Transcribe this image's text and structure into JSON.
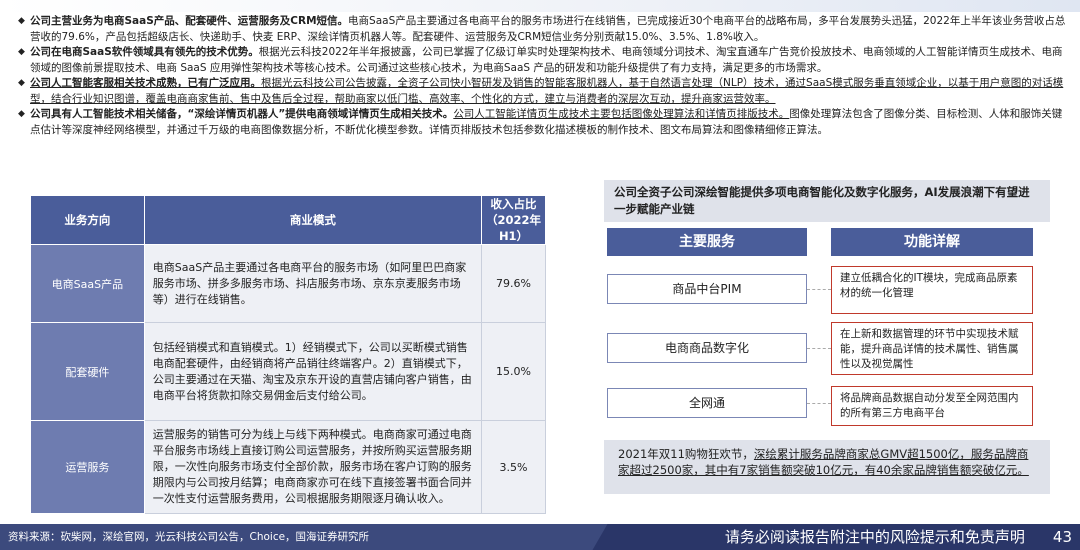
{
  "bullets": [
    {
      "head": "公司主营业务为电商SaaS产品、配套硬件、运营服务及CRM短信。",
      "body": "电商SaaS产品主要通过各电商平台的服务市场进行在线销售，已完成接近30个电商平台的战略布局，多平台发展势头迅猛，2022年上半年该业务营收占总营收的79.6%，产品包括超级店长、快递助手、快麦 ERP、深绘详情页机器人等。配套硬件、运营服务及CRM短信业务分别贡献15.0%、3.5%、1.8%收入。"
    },
    {
      "head": "公司在电商SaaS软件领域具有领先的技术优势。",
      "body": "根据光云科技2022年半年报披露，公司已掌握了亿级订单实时处理架构技术、电商领域分词技术、淘宝直通车广告竞价投放技术、电商领域的人工智能详情页生成技术、电商领域的图像前景提取技术、电商 SaaS 应用弹性架构技术等核心技术。公司通过这些核心技术，为电商SaaS 产品的研发和功能升级提供了有力支持，满足更多的市场需求。"
    },
    {
      "head": "公司人工智能客服相关技术成熟，已有广泛应用。",
      "body": "根据光云科技公司公告披露，全资子公司快小智研发及销售的智能客服机器人，基于自然语言处理（NLP）技术，通过SaaS模式服务垂直领域企业，以基于用户意图的对话模型，结合行业知识图谱，覆盖电商商家售前、售中及售后全过程，帮助商家以低门槛、高效率、个性化的方式，建立与消费者的深层次互动，提升商家运营效率。"
    },
    {
      "head": "公司具有人工智能技术相关储备，“深绘详情页机器人”提供电商领域详情页生成相关技术。",
      "body": "公司人工智能详情页生成技术主要包括图像处理算法和详情页排版技术。图像处理算法包含了图像分类、目标检测、人体和服饰关键点估计等深度神经网络模型，并通过千万级的电商图像数据分析，不断优化模型参数。详情页排版技术包括参数化描述模板的制作技术、图文布局算法和图像精细修正算法。",
      "body_underlined": "公司人工智能详情页生成技术主要包括图像处理算法和详情页排版技术。",
      "body_rest": "图像处理算法包含了图像分类、目标检测、人体和服饰关键点估计等深度神经网络模型，并通过千万级的电商图像数据分析，不断优化模型参数。详情页排版技术包括参数化描述模板的制作技术、图文布局算法和图像精细修正算法。"
    }
  ],
  "table": {
    "headers": [
      "业务方向",
      "商业模式",
      "收入占比（2022年H1）"
    ],
    "rows": [
      {
        "direction": "电商SaaS产品",
        "model": "电商SaaS产品主要通过各电商平台的服务市场（如阿里巴巴商家服务市场、拼多多服务市场、抖店服务市场、京东京麦服务市场等）进行在线销售。",
        "share": "79.6%"
      },
      {
        "direction": "配套硬件",
        "model": "包括经销模式和直销模式。1）经销模式下，公司以买断模式销售电商配套硬件，由经销商将产品销往终端客户。2）直销模式下，公司主要通过在天猫、淘宝及京东开设的直营店铺向客户销售，由电商平台将货款扣除交易佣金后支付给公司。",
        "share": "15.0%"
      },
      {
        "direction": "运营服务",
        "model": "运营服务的销售可分为线上与线下两种模式。电商商家可通过电商平台服务市场线上直接订购公司运营服务，并按所购买运营服务期限，一次性向服务市场支付全部价款，服务市场在客户订购的服务期限内与公司按月结算；电商商家亦可在线下直接签署书面合同并一次性支付运营服务费用，公司根据服务期限逐月确认收入。",
        "share": "3.5%"
      }
    ]
  },
  "right_panel": {
    "title": "公司全资子公司深绘智能提供多项电商智能化及数字化服务，AI发展浪潮下有望进一步赋能产业链",
    "header_services": "主要服务",
    "header_details": "功能详解",
    "services": [
      {
        "name": "商品中台PIM",
        "detail": "建立低耦合化的IT模块，完成商品原素材的统一化管理"
      },
      {
        "name": "电商商品数字化",
        "detail": "在上新和数据管理的环节中实现技术赋能，提升商品详情的技术属性、销售属性以及视觉属性"
      },
      {
        "name": "全网通",
        "detail": "将品牌商品数据自动分发至全网范围内的所有第三方电商平台"
      }
    ],
    "bottom_plain": "2021年双11购物狂欢节，",
    "bottom_underlined": "深绘累计服务品牌商家总GMV超1500亿，服务品牌商家超过2500家，其中有7家销售额突破10亿元，有40余家品牌销售额突破亿元。"
  },
  "footer": {
    "source": "资料来源：砍柴网，深绘官网，光云科技公司公告，Choice，国海证券研究所",
    "disclaimer": "请务必阅读报告附注中的风险提示和免责声明",
    "page": "43"
  }
}
